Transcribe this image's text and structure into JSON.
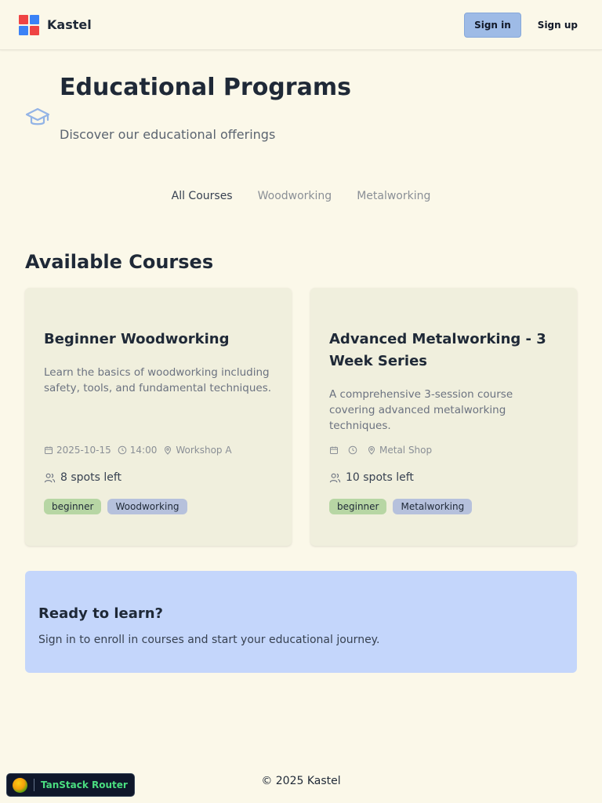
{
  "header": {
    "app_name": "Kastel",
    "signin_label": "Sign in",
    "signup_label": "Sign up",
    "logo_colors": [
      "#ef4444",
      "#3b82f6",
      "#3b82f6",
      "#ef4444"
    ]
  },
  "hero": {
    "title": "Educational Programs",
    "subtitle": "Discover our educational offerings",
    "icon": "graduation-cap-icon"
  },
  "tabs": [
    {
      "label": "All Courses",
      "active": true
    },
    {
      "label": "Woodworking",
      "active": false
    },
    {
      "label": "Metalworking",
      "active": false
    }
  ],
  "courses_section": {
    "title": "Available Courses"
  },
  "courses": [
    {
      "title": "Beginner Woodworking",
      "description": "Learn the basics of woodworking including safety, tools, and fundamental techniques.",
      "date": "2025-10-15",
      "time": "14:00",
      "location": "Workshop A",
      "spots": "8 spots left",
      "level": "beginner",
      "category": "Woodworking"
    },
    {
      "title": "Advanced Metalworking - 3 Week Series",
      "description": "A comprehensive 3-session course covering advanced metalworking techniques.",
      "date": "",
      "time": "",
      "location": "Metal Shop",
      "spots": "10 spots left",
      "level": "beginner",
      "category": "Metalworking"
    }
  ],
  "cta": {
    "title": "Ready to learn?",
    "text": "Sign in to enroll in courses and start your educational journey."
  },
  "footer": {
    "copyright": "© 2025 Kastel"
  },
  "devtools": {
    "label": "TanStack Router"
  },
  "colors": {
    "background": "#fbf8e9",
    "card": "#f0efdd",
    "accent": "#9ebbe6",
    "cta": "#c4d6fb",
    "badge_level": "#b7d6a4",
    "badge_category": "#b6c1dc"
  }
}
